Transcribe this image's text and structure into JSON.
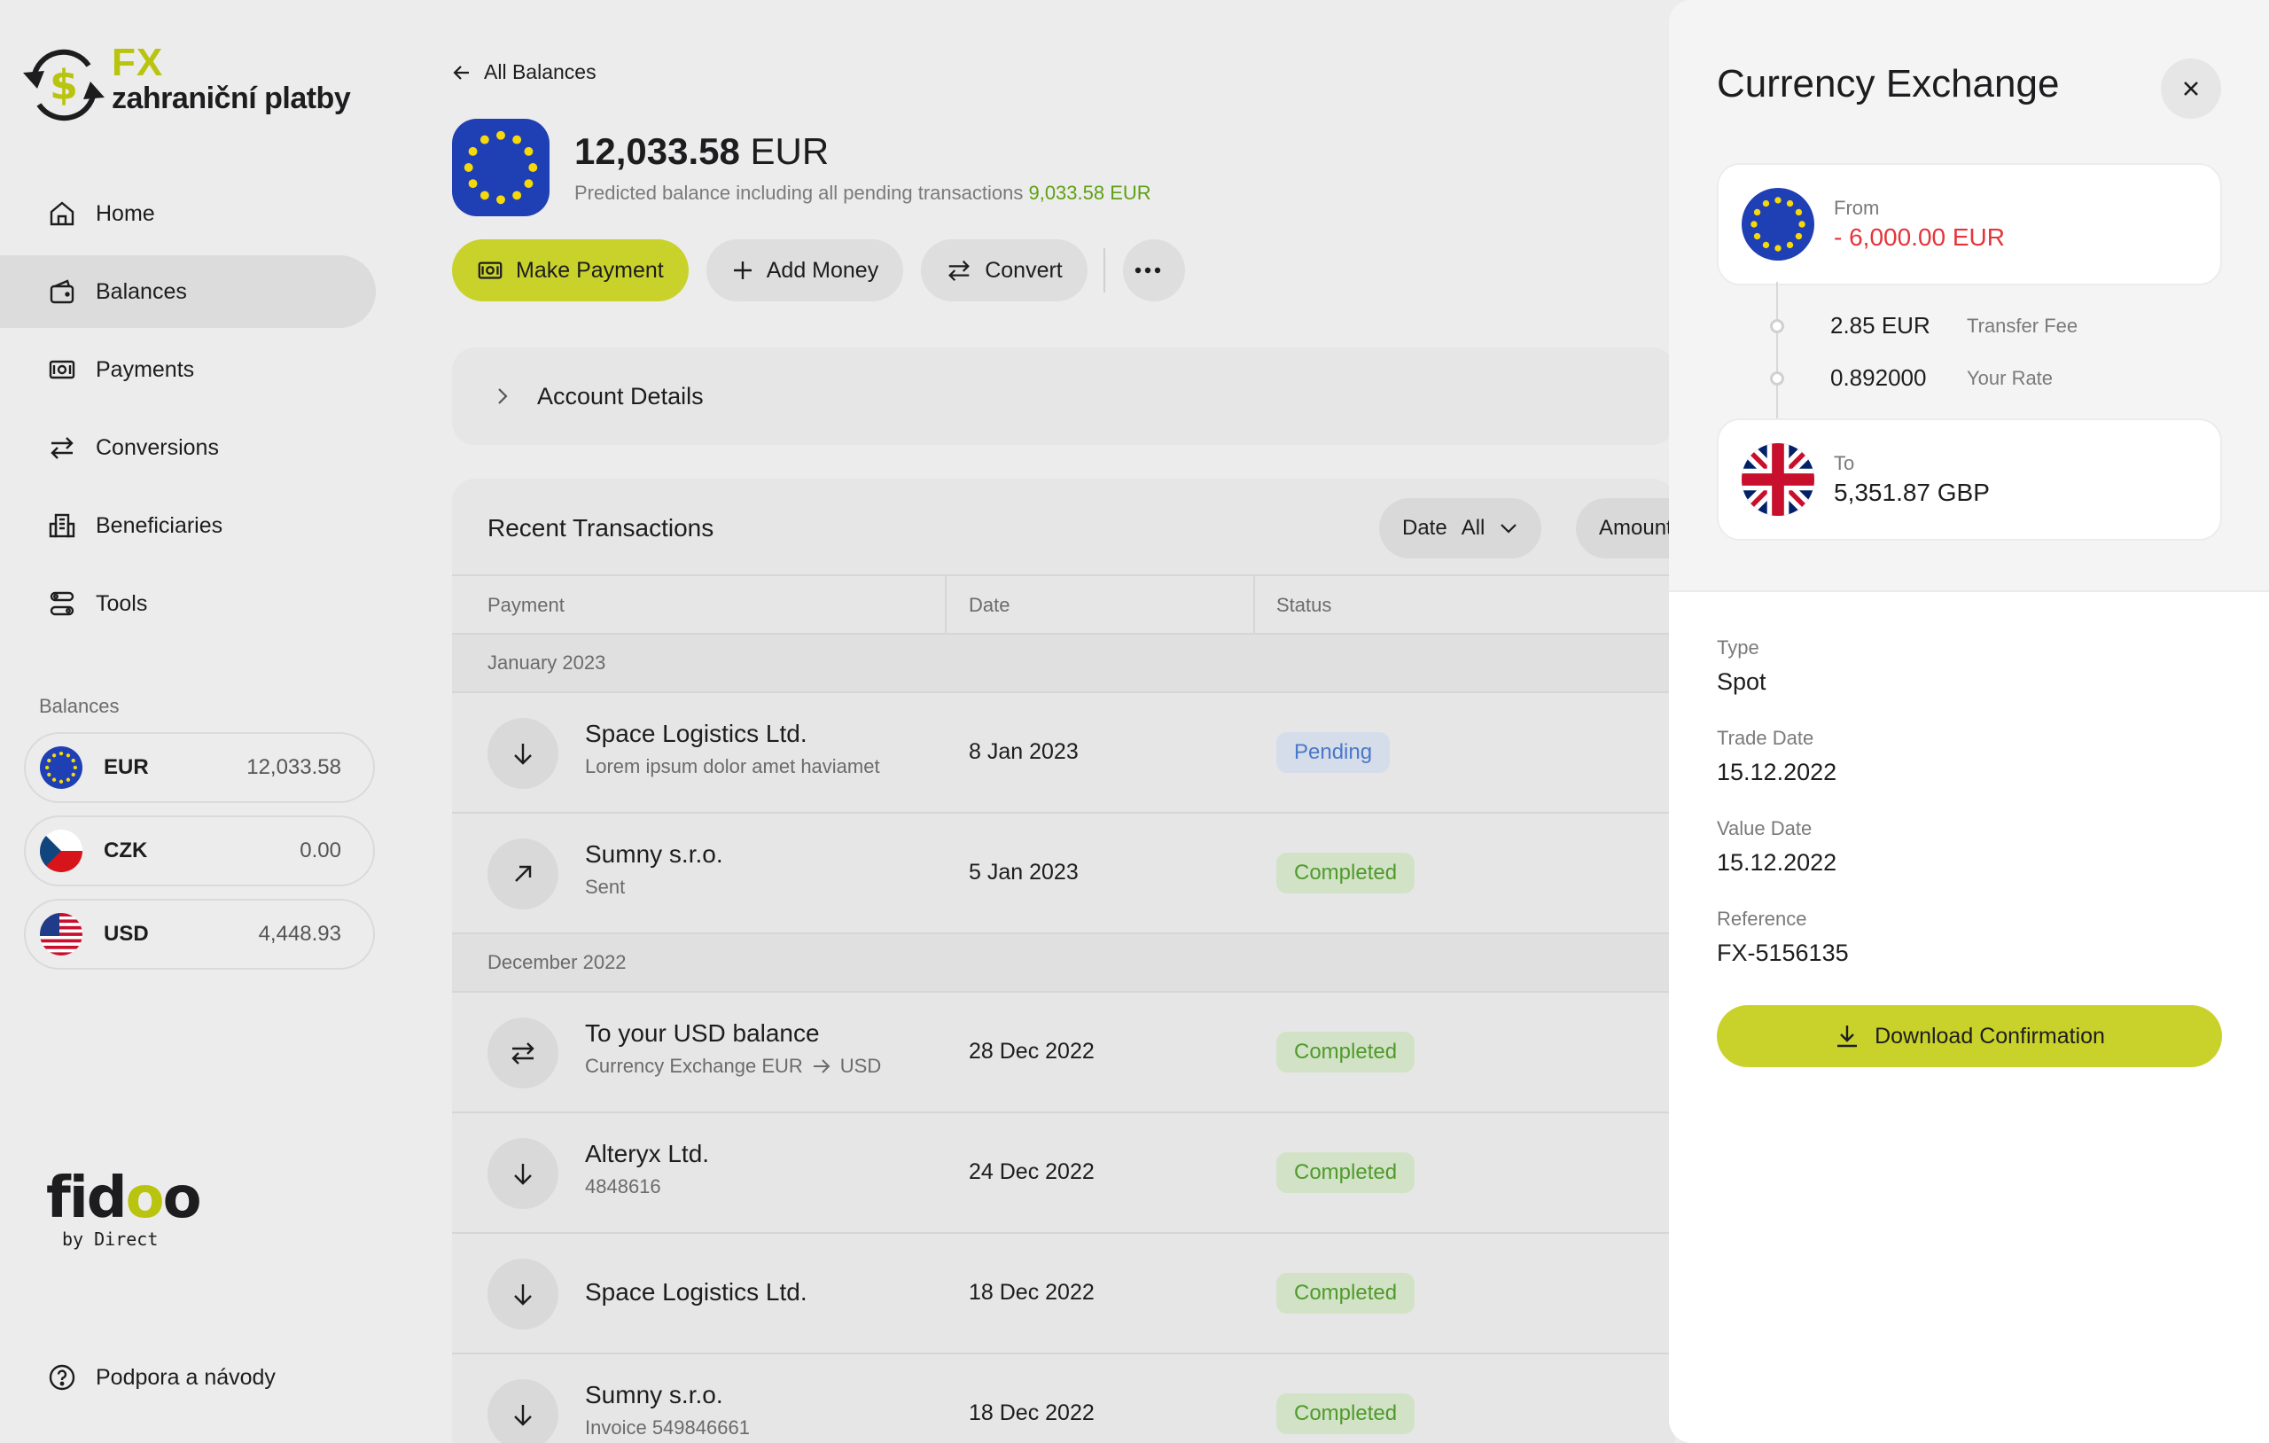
{
  "logo": {
    "fx": "FX",
    "text": "zahraniční platby"
  },
  "nav": [
    {
      "label": "Home",
      "icon": "home-icon"
    },
    {
      "label": "Balances",
      "icon": "wallet-icon"
    },
    {
      "label": "Payments",
      "icon": "banknote-icon"
    },
    {
      "label": "Conversions",
      "icon": "swap-icon"
    },
    {
      "label": "Beneficiaries",
      "icon": "building-icon"
    },
    {
      "label": "Tools",
      "icon": "tools-icon"
    }
  ],
  "balances": {
    "title": "Balances",
    "items": [
      {
        "code": "EUR",
        "amount": "12,033.58"
      },
      {
        "code": "CZK",
        "amount": "0.00"
      },
      {
        "code": "USD",
        "amount": "4,448.93"
      }
    ]
  },
  "brand": {
    "main_a": "fid",
    "main_b": "o",
    "main_c": "o",
    "sub": "by Direct"
  },
  "support": {
    "label": "Podpora a návody"
  },
  "main": {
    "back_label": "All Balances",
    "amount_value": "12,033.58",
    "amount_currency": "EUR",
    "predicted_text": "Predicted balance including all pending transactions",
    "predicted_amount": "9,033.58 EUR",
    "actions": {
      "make_payment": "Make Payment",
      "add_money": "Add Money",
      "convert": "Convert"
    },
    "account_details": "Account Details",
    "transactions": {
      "title": "Recent Transactions",
      "filter_date_label": "Date",
      "filter_date_value": "All",
      "filter_amount_label": "Amount",
      "columns": {
        "payment": "Payment",
        "date": "Date",
        "status": "Status"
      },
      "groups": [
        {
          "label": "January 2023",
          "rows": [
            {
              "name": "Space Logistics Ltd.",
              "sub": "Lorem ipsum dolor amet haviamet",
              "date": "8 Jan 2023",
              "status": "Pending",
              "icon": "arrow-down-icon"
            },
            {
              "name": "Sumny s.r.o.",
              "sub": "Sent",
              "date": "5 Jan 2023",
              "status": "Completed",
              "icon": "arrow-up-right-icon"
            }
          ]
        },
        {
          "label": "December 2022",
          "rows": [
            {
              "name": "To your USD balance",
              "sub_from": "Currency Exchange EUR",
              "sub_to": "USD",
              "date": "28 Dec 2022",
              "status": "Completed",
              "icon": "swap-icon"
            },
            {
              "name": "Alteryx Ltd.",
              "sub": "4848616",
              "date": "24 Dec 2022",
              "status": "Completed",
              "icon": "arrow-down-icon"
            },
            {
              "name": "Space Logistics Ltd.",
              "sub": "",
              "date": "18 Dec 2022",
              "status": "Completed",
              "icon": "arrow-down-icon"
            },
            {
              "name": "Sumny s.r.o.",
              "sub": "Invoice 549846661",
              "date": "18 Dec 2022",
              "status": "Completed",
              "icon": "arrow-down-icon"
            }
          ]
        }
      ]
    }
  },
  "drawer": {
    "title": "Currency Exchange",
    "from_label": "From",
    "from_amount": "- 6,000.00 EUR",
    "fee_value": "2.85 EUR",
    "fee_label": "Transfer Fee",
    "rate_value": "0.892000",
    "rate_label": "Your Rate",
    "to_label": "To",
    "to_amount": "5,351.87 GBP",
    "type_label": "Type",
    "type_value": "Spot",
    "trade_date_label": "Trade Date",
    "trade_date_value": "15.12.2022",
    "value_date_label": "Value Date",
    "value_date_value": "15.12.2022",
    "reference_label": "Reference",
    "reference_value": "FX-5156135",
    "download_label": "Download Confirmation"
  },
  "colors": {
    "accent": "#c9d22a",
    "brand_green": "#b9c40f",
    "negative": "#e5343b",
    "pending_text": "#4a78c8",
    "completed_text": "#4f9a2b",
    "predicted_green": "#5fa014"
  }
}
